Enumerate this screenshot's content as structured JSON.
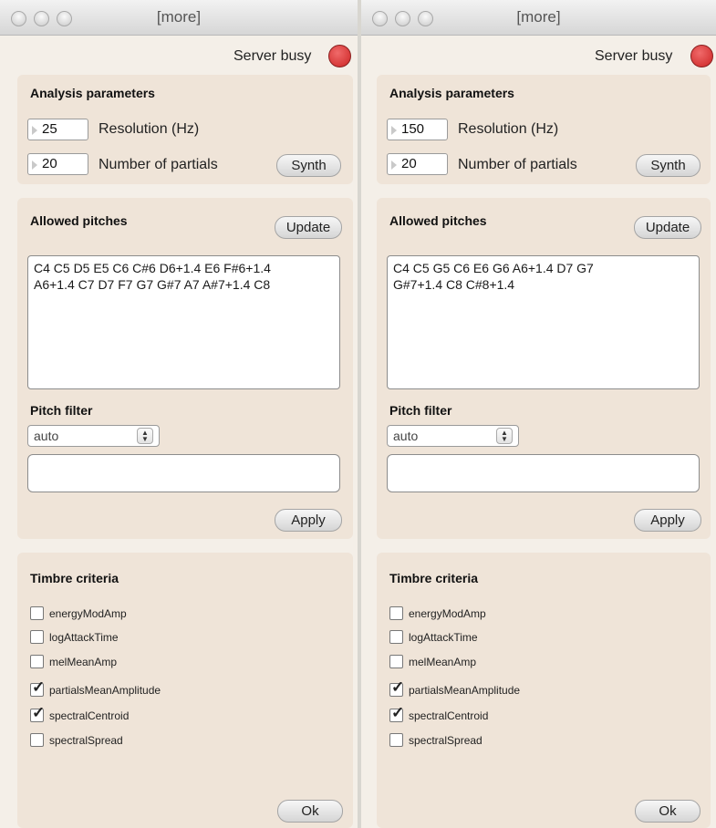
{
  "windows": [
    {
      "title": "[more]",
      "server_status": "Server busy",
      "analysis": {
        "heading": "Analysis parameters",
        "resolution_value": "25",
        "resolution_label": "Resolution (Hz)",
        "partials_value": "20",
        "partials_label": "Number of partials",
        "synth_label": "Synth"
      },
      "pitches": {
        "heading": "Allowed pitches",
        "update_label": "Update",
        "lines": [
          "C4 C5 D5 E5 C6 C#6 D6+1.4 E6 F#6+1.4",
          "A6+1.4 C7 D7 F7 G7 G#7 A7 A#7+1.4 C8"
        ],
        "filter_heading": "Pitch filter",
        "filter_mode": "auto",
        "filter_text": "",
        "apply_label": "Apply"
      },
      "timbre": {
        "heading": "Timbre criteria",
        "criteria": [
          {
            "label": "energyModAmp",
            "checked": false
          },
          {
            "label": "logAttackTime",
            "checked": false
          },
          {
            "label": "melMeanAmp",
            "checked": false
          },
          {
            "label": "partialsMeanAmplitude",
            "checked": true
          },
          {
            "label": "spectralCentroid",
            "checked": true
          },
          {
            "label": "spectralSpread",
            "checked": false
          }
        ],
        "ok_label": "Ok"
      }
    },
    {
      "title": "[more]",
      "server_status": "Server busy",
      "analysis": {
        "heading": "Analysis parameters",
        "resolution_value": "150",
        "resolution_label": "Resolution (Hz)",
        "partials_value": "20",
        "partials_label": "Number of partials",
        "synth_label": "Synth"
      },
      "pitches": {
        "heading": "Allowed pitches",
        "update_label": "Update",
        "lines": [
          "C4 C5 G5 C6 E6 G6 A6+1.4 D7 G7",
          "G#7+1.4 C8 C#8+1.4"
        ],
        "filter_heading": "Pitch filter",
        "filter_mode": "auto",
        "filter_text": "",
        "apply_label": "Apply"
      },
      "timbre": {
        "heading": "Timbre criteria",
        "criteria": [
          {
            "label": "energyModAmp",
            "checked": false
          },
          {
            "label": "logAttackTime",
            "checked": false
          },
          {
            "label": "melMeanAmp",
            "checked": false
          },
          {
            "label": "partialsMeanAmplitude",
            "checked": true
          },
          {
            "label": "spectralCentroid",
            "checked": true
          },
          {
            "label": "spectralSpread",
            "checked": false
          }
        ],
        "ok_label": "Ok"
      }
    }
  ],
  "colors": {
    "window_bg": "#f4efe8",
    "panel_bg": "#efe4d8",
    "busy_indicator": "#d93a3a"
  },
  "icons": {
    "window_controls": [
      "close-icon",
      "minimize-icon",
      "zoom-icon"
    ],
    "checkmark": "check-icon",
    "stepper": "up-down-arrows-icon"
  }
}
